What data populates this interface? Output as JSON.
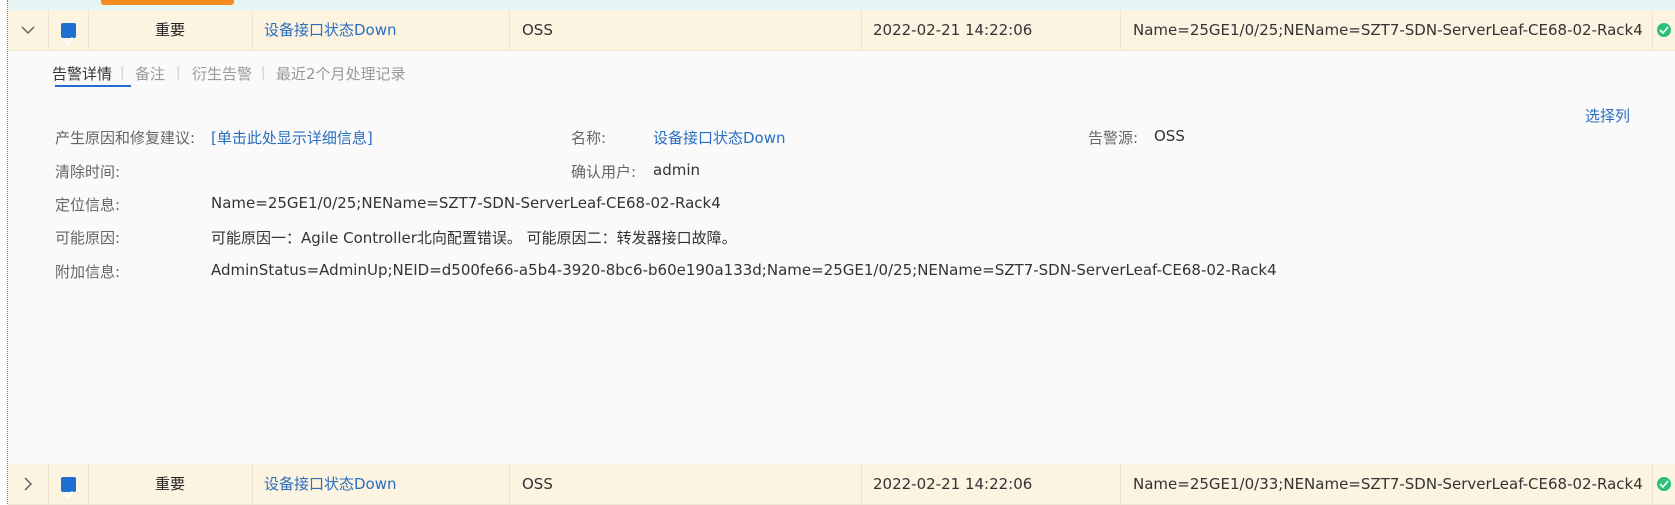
{
  "rows": [
    {
      "severity": "重要",
      "alarm_name": "设备接口状态Down",
      "source": "OSS",
      "time": "2022-02-21 14:22:06",
      "location": "Name=25GE1/0/25;NEName=SZT7-SDN-ServerLeaf-CE68-02-Rack4"
    },
    {
      "severity": "重要",
      "alarm_name": "设备接口状态Down",
      "source": "OSS",
      "time": "2022-02-21 14:22:06",
      "location": "Name=25GE1/0/33;NEName=SZT7-SDN-ServerLeaf-CE68-02-Rack4"
    }
  ],
  "detail": {
    "tabs": [
      "告警详情",
      "备注",
      "衍生告警",
      "最近2个月处理记录"
    ],
    "select_columns": "选择列",
    "fields": {
      "cause_label": "产生原因和修复建议:",
      "cause_value": "[单击此处显示详细信息]",
      "name_label": "名称:",
      "name_value": "设备接口状态Down",
      "source_label": "告警源:",
      "source_value": "OSS",
      "clear_time_label": "清除时间:",
      "clear_time_value": "",
      "confirm_user_label": "确认用户:",
      "confirm_user_value": "admin",
      "location_label": "定位信息:",
      "location_value": "Name=25GE1/0/25;NEName=SZT7-SDN-ServerLeaf-CE68-02-Rack4",
      "possible_cause_label": "可能原因:",
      "possible_cause_value": "可能原因一：Agile Controller北向配置错误。 可能原因二：转发器接口故障。",
      "extra_label": "附加信息:",
      "extra_value": "AdminStatus=AdminUp;NEID=d500fe66-a5b4-3920-8bc6-b60e190a133d;Name=25GE1/0/25;NEName=SZT7-SDN-ServerLeaf-CE68-02-Rack4"
    }
  },
  "colors": {
    "row_bg": "#fdf3e1",
    "link": "#2a6fbf",
    "checkbox": "#1f6fd0",
    "status_ok": "#2dbf7a",
    "active_tab_indicator": "#f58a1f"
  },
  "icons": {
    "expanded": "chevron-down-icon",
    "collapsed": "chevron-right-icon",
    "status": "check-circle-icon"
  }
}
